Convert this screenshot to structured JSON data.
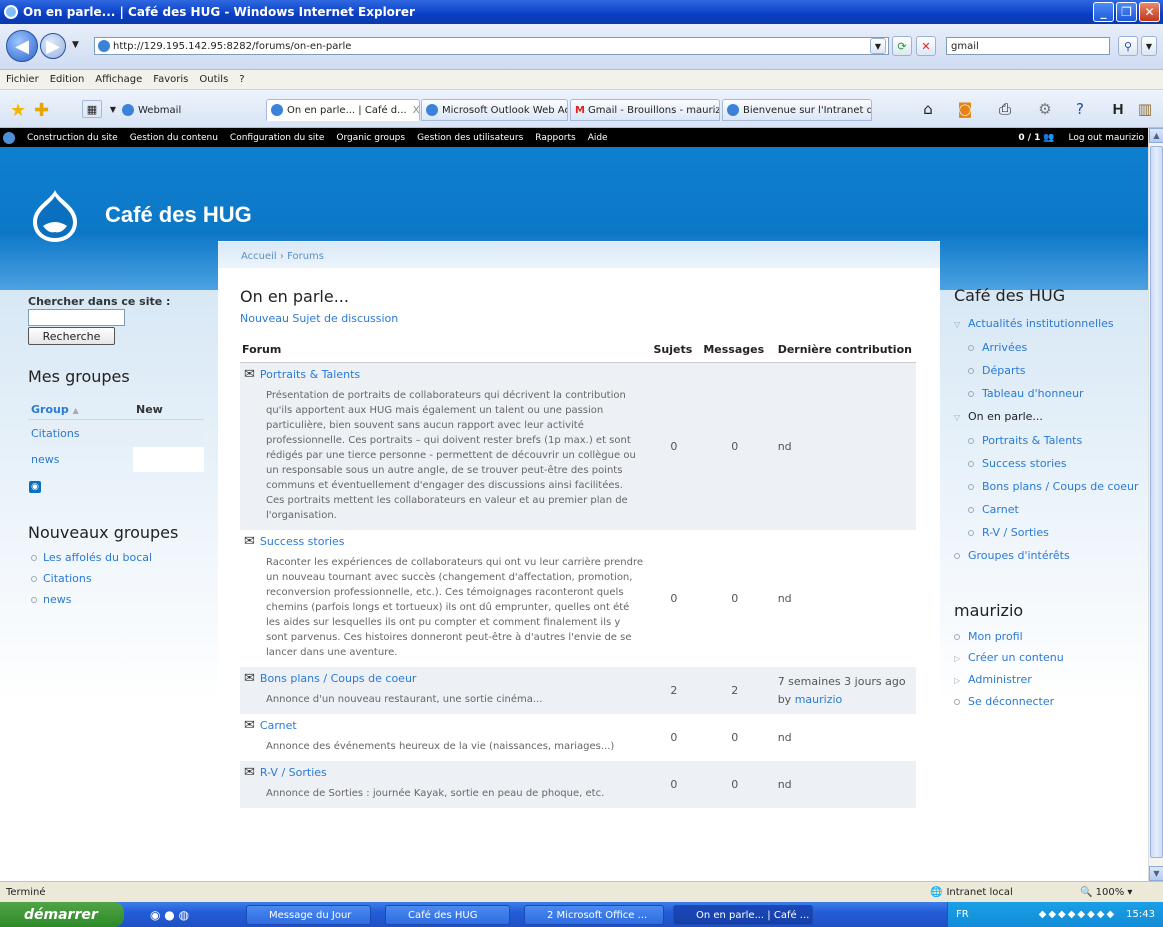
{
  "window": {
    "title": "On en parle... | Café des HUG - Windows Internet Explorer"
  },
  "browser": {
    "url": "http://129.195.142.95:8282/forums/on-en-parle",
    "search_value": "gmail",
    "menu": [
      "Fichier",
      "Edition",
      "Affichage",
      "Favoris",
      "Outils",
      "?"
    ],
    "tabs": [
      {
        "label": "Webmail",
        "active": false
      },
      {
        "label": "On en parle... | Café d...",
        "active": true
      },
      {
        "label": "Microsoft Outlook Web Acc...",
        "active": false
      },
      {
        "label": "Gmail - Brouillons - maurizi...",
        "active": false
      },
      {
        "label": "Bienvenue sur l'Intranet d...",
        "active": false
      }
    ],
    "tab_close": "X"
  },
  "adminbar": {
    "items": [
      "Construction du site",
      "Gestion du contenu",
      "Configuration du site",
      "Organic groups",
      "Gestion des utilisateurs",
      "Rapports",
      "Aide"
    ],
    "users_count": "0 / 1",
    "logout": "Log out maurizio"
  },
  "site": {
    "name": "Café des HUG"
  },
  "breadcrumb": "Accueil › Forums",
  "left": {
    "search_label": "Chercher dans ce site :",
    "search_button": "Recherche",
    "my_groups_title": "Mes groupes",
    "groups_table": {
      "headers": [
        "Group",
        "New"
      ],
      "rows": [
        "Citations",
        "news"
      ]
    },
    "new_groups_title": "Nouveaux groupes",
    "new_groups": [
      "Les affolés du bocal",
      "Citations",
      "news"
    ]
  },
  "main": {
    "title": "On en parle...",
    "new_topic": "Nouveau Sujet de discussion",
    "columns": [
      "Forum",
      "Sujets",
      "Messages",
      "Dernière contribution"
    ],
    "forums": [
      {
        "name": "Portraits & Talents",
        "desc": "Présentation de portraits de collaborateurs qui décrivent la contribution qu'ils apportent aux HUG mais également un talent ou une passion particulière, bien souvent sans aucun rapport avec leur activité professionnelle. Ces portraits – qui doivent rester brefs (1p max.) et sont rédigés par une tierce personne - permettent de découvrir un collègue ou un responsable sous un autre angle, de se trouver peut-être des points communs et éventuellement d'engager des discussions ainsi facilitées. Ces portraits mettent les collaborateurs en valeur et au premier plan de l'organisation.",
        "topics": "0",
        "posts": "0",
        "last": "nd",
        "last_by": ""
      },
      {
        "name": "Success stories",
        "desc": "Raconter les expériences de collaborateurs qui ont vu leur carrière prendre un nouveau tournant avec succès (changement d'affectation, promotion, reconversion professionnelle, etc.). Ces témoignages raconteront quels chemins (parfois longs et tortueux) ils ont dû emprunter, quelles ont été les aides sur lesquelles ils ont pu compter et comment finalement ils y sont parvenus. Ces histoires donneront peut-être à d'autres l'envie de se lancer dans une aventure.",
        "topics": "0",
        "posts": "0",
        "last": "nd",
        "last_by": ""
      },
      {
        "name": "Bons plans / Coups de coeur",
        "desc": "Annonce d'un nouveau restaurant, une sortie cinéma...",
        "topics": "2",
        "posts": "2",
        "last": "7 semaines 3 jours ago",
        "last_by": "maurizio"
      },
      {
        "name": "Carnet",
        "desc": "Annonce des événements heureux de la vie (naissances, mariages...)",
        "topics": "0",
        "posts": "0",
        "last": "nd",
        "last_by": ""
      },
      {
        "name": "R-V / Sorties",
        "desc": "Annonce de Sorties : journée Kayak, sortie en peau de phoque, etc.",
        "topics": "0",
        "posts": "0",
        "last": "nd",
        "last_by": ""
      }
    ]
  },
  "right": {
    "nav_title": "Café des HUG",
    "nav": [
      {
        "label": "Actualités institutionnelles",
        "level": 0,
        "marker": "open",
        "link": true
      },
      {
        "label": "Arrivées",
        "level": 1,
        "marker": "leaf",
        "link": true
      },
      {
        "label": "Départs",
        "level": 1,
        "marker": "leaf",
        "link": true
      },
      {
        "label": "Tableau d'honneur",
        "level": 1,
        "marker": "leaf",
        "link": true
      },
      {
        "label": "On en parle...",
        "level": 0,
        "marker": "open",
        "link": false
      },
      {
        "label": "Portraits & Talents",
        "level": 1,
        "marker": "leaf",
        "link": true
      },
      {
        "label": "Success stories",
        "level": 1,
        "marker": "leaf",
        "link": true
      },
      {
        "label": "Bons plans / Coups de coeur",
        "level": 1,
        "marker": "leaf",
        "link": true
      },
      {
        "label": "Carnet",
        "level": 1,
        "marker": "leaf",
        "link": true
      },
      {
        "label": "R-V / Sorties",
        "level": 1,
        "marker": "leaf",
        "link": true
      },
      {
        "label": "Groupes d'intérêts",
        "level": 0,
        "marker": "leaf",
        "link": true
      }
    ],
    "user_title": "maurizio",
    "user_menu": [
      {
        "label": "Mon profil",
        "marker": "leaf"
      },
      {
        "label": "Créer un contenu",
        "marker": "closed"
      },
      {
        "label": "Administrer",
        "marker": "closed"
      },
      {
        "label": "Se déconnecter",
        "marker": "leaf"
      }
    ]
  },
  "statusbar": {
    "text": "Terminé",
    "zone": "Intranet local",
    "zoom": "100%"
  },
  "taskbar": {
    "start": "démarrer",
    "tasks": [
      "Message du Jour",
      "Café des HUG",
      "2 Microsoft Office ...",
      "On en parle... | Café ..."
    ],
    "lang": "FR",
    "time": "15:43"
  }
}
